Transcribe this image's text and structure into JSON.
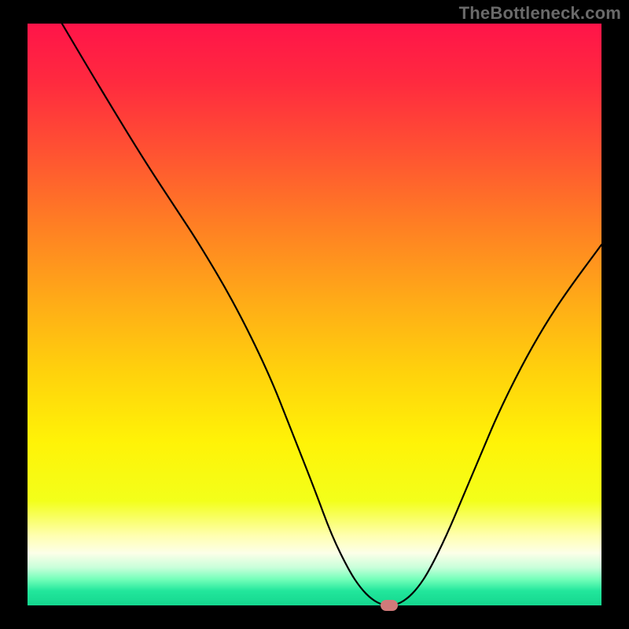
{
  "watermark": "TheBottleneck.com",
  "colors": {
    "frame": "#000000",
    "curve": "#000000",
    "marker": "#d17a7a",
    "gradient_stops": [
      {
        "offset": 0.0,
        "color": "#ff1449"
      },
      {
        "offset": 0.1,
        "color": "#ff2a3f"
      },
      {
        "offset": 0.22,
        "color": "#ff5232"
      },
      {
        "offset": 0.35,
        "color": "#ff8023"
      },
      {
        "offset": 0.48,
        "color": "#ffac17"
      },
      {
        "offset": 0.6,
        "color": "#ffd20c"
      },
      {
        "offset": 0.72,
        "color": "#fff307"
      },
      {
        "offset": 0.82,
        "color": "#f3ff1a"
      },
      {
        "offset": 0.88,
        "color": "#ffffb0"
      },
      {
        "offset": 0.91,
        "color": "#fcffe8"
      },
      {
        "offset": 0.935,
        "color": "#c8ffda"
      },
      {
        "offset": 0.955,
        "color": "#74ffba"
      },
      {
        "offset": 0.975,
        "color": "#22e79c"
      },
      {
        "offset": 1.0,
        "color": "#14d68e"
      }
    ]
  },
  "chart_data": {
    "type": "line",
    "title": "",
    "xlabel": "",
    "ylabel": "",
    "xlim": [
      0,
      100
    ],
    "ylim": [
      0,
      100
    ],
    "x": [
      6,
      12,
      20,
      26,
      30,
      36,
      42,
      46,
      50,
      53,
      56,
      58,
      60,
      62,
      64,
      66,
      68,
      70,
      73,
      76,
      79,
      82,
      86,
      90,
      94,
      100
    ],
    "values": [
      100,
      90,
      77,
      68,
      62,
      52,
      40,
      30,
      20,
      12,
      6,
      3,
      1,
      0,
      0,
      1,
      3,
      6,
      12,
      19,
      26,
      33,
      41,
      48,
      54,
      62
    ],
    "marker": {
      "x": 63,
      "y": 0
    },
    "annotations": []
  }
}
